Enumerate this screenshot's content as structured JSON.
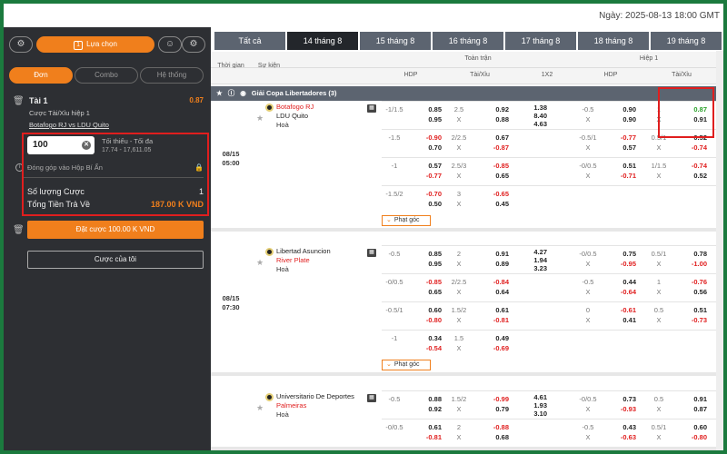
{
  "header": {
    "date": "Ngày: 2025-08-13 18:00 GMT"
  },
  "betslip": {
    "selection_label": "Lựa chọn",
    "selection_count": "1",
    "tabs": [
      "Đơn",
      "Combo",
      "Hệ thống"
    ],
    "bet": {
      "title": "Tài 1",
      "odds": "0.87",
      "market": "Cược Tài/Xỉu hiệp 1",
      "match": "Botafogo RJ vs LDU Quito"
    },
    "stake": "100",
    "limit_label": "Tối thiểu - Tối đa",
    "limit_value": "17.74 - 17,611.05",
    "contribution": "Đóng góp vào Hộp Bí Ẩn",
    "stake_count_label": "Số lượng Cược",
    "stake_count": "1",
    "payout_label": "Tổng Tiền Trả Về",
    "payout": "187.00 K VND",
    "place_button": "Đặt cược 100.00 K VND",
    "my_bets": "Cược của tôi"
  },
  "date_tabs": [
    "Tất cả",
    "14 tháng 8",
    "15 tháng 8",
    "16 tháng 8",
    "17 tháng 8",
    "18 tháng 8",
    "19 tháng 8"
  ],
  "columns": {
    "time": "Thời gian",
    "event": "Sự kiện",
    "full": "Toàn trận",
    "half": "Hiệp 1",
    "hdp": "HDP",
    "ou": "Tài/Xỉu",
    "x12": "1X2",
    "hdp2": "HDP",
    "ou2": "Tài/Xỉu"
  },
  "league": "Giải Copa Libertadores (3)",
  "corner_label": "Phạt góc",
  "matches": [
    {
      "date": "08/15",
      "time": "05:00",
      "home": "Botafogo RJ",
      "away": "LDU Quito",
      "draw": "Hoà",
      "home_red": true,
      "rows": [
        {
          "h": "-1/1.5",
          "h1": "0.85",
          "h2": "0.95",
          "o": "2.5",
          "o1": "0.92",
          "o2": "0.88",
          "x1": "1.38",
          "x2": "8.40",
          "x3": "4.63",
          "hh": "-0.5",
          "hh1": "0.90",
          "hh2": "0.90",
          "ho": "1",
          "ho1": "0.87",
          "ho2": "0.91"
        },
        {
          "h": "-1.5",
          "h1": "-0.90",
          "h2": "0.70",
          "o": "2/2.5",
          "o1": "0.67",
          "o2": "-0.87",
          "hh": "-0.5/1",
          "hh1": "-0.77",
          "hh2": "0.57",
          "ho": "0.5/1",
          "ho1": "0.52",
          "ho2": "-0.74"
        },
        {
          "h": "-1",
          "h1": "0.57",
          "h2": "-0.77",
          "o": "2.5/3",
          "o1": "-0.85",
          "o2": "0.65",
          "hh": "-0/0.5",
          "hh1": "0.51",
          "hh2": "-0.71",
          "ho": "1/1.5",
          "ho1": "-0.74",
          "ho2": "0.52"
        },
        {
          "h": "-1.5/2",
          "h1": "-0.70",
          "h2": "0.50",
          "o": "3",
          "o1": "-0.65",
          "o2": "0.45"
        }
      ]
    },
    {
      "date": "08/15",
      "time": "07:30",
      "home": "Libertad Asuncion",
      "away": "River Plate",
      "draw": "Hoà",
      "home_red": false,
      "rows": [
        {
          "h": "-0.5",
          "h1": "0.85",
          "h2": "0.95",
          "o": "2",
          "o1": "0.91",
          "o2": "0.89",
          "x1": "4.27",
          "x2": "1.94",
          "x3": "3.23",
          "hh": "-0/0.5",
          "hh1": "0.75",
          "hh2": "-0.95",
          "ho": "0.5/1",
          "ho1": "0.78",
          "ho2": "-1.00"
        },
        {
          "h": "-0/0.5",
          "h1": "-0.85",
          "h2": "0.65",
          "o": "2/2.5",
          "o1": "-0.84",
          "o2": "0.64",
          "hh": "-0.5",
          "hh1": "0.44",
          "hh2": "-0.64",
          "ho": "1",
          "ho1": "-0.76",
          "ho2": "0.56"
        },
        {
          "h": "-0.5/1",
          "h1": "0.60",
          "h2": "-0.80",
          "o": "1.5/2",
          "o1": "0.61",
          "o2": "-0.81",
          "hh": "0",
          "hh1": "-0.61",
          "hh2": "0.41",
          "ho": "0.5",
          "ho1": "0.51",
          "ho2": "-0.73"
        },
        {
          "h": "-1",
          "h1": "0.34",
          "h2": "-0.54",
          "o": "1.5",
          "o1": "0.49",
          "o2": "-0.69"
        }
      ]
    },
    {
      "date": "",
      "time": "",
      "home": "Universitario De Deportes",
      "away": "Palmeiras",
      "draw": "Hoà",
      "home_red": false,
      "rows": [
        {
          "h": "-0.5",
          "h1": "0.88",
          "h2": "0.92",
          "o": "1.5/2",
          "o1": "-0.99",
          "o2": "0.79",
          "x1": "4.61",
          "x2": "1.93",
          "x3": "3.10",
          "hh": "-0/0.5",
          "hh1": "0.73",
          "hh2": "-0.93",
          "ho": "0.5",
          "ho1": "0.91",
          "ho2": "0.87"
        },
        {
          "h": "-0/0.5",
          "h1": "0.61",
          "h2": "-0.81",
          "o": "2",
          "o1": "-0.88",
          "o2": "0.68",
          "hh": "-0.5",
          "hh1": "0.43",
          "hh2": "-0.63",
          "ho": "0.5/1",
          "ho1": "0.60",
          "ho2": "-0.80"
        }
      ]
    }
  ]
}
